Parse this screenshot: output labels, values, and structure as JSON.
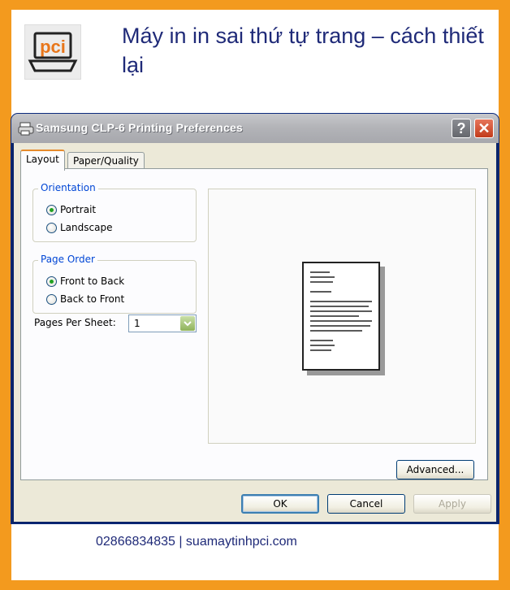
{
  "page": {
    "headline": "Máy in in sai thứ tự trang – cách thiết lại",
    "footer": "02866834835 | suamaytinhpci.com",
    "logo_text": "pci"
  },
  "window": {
    "title": "Samsung CLP-6 Printing Preferences",
    "help_glyph": "?",
    "close_glyph": "✕"
  },
  "tabs": [
    {
      "label": "Layout",
      "active": true
    },
    {
      "label": "Paper/Quality",
      "active": false
    }
  ],
  "orientation": {
    "legend": "Orientation",
    "options": [
      {
        "label": "Portrait",
        "checked": true
      },
      {
        "label": "Landscape",
        "checked": false
      }
    ]
  },
  "page_order": {
    "legend": "Page Order",
    "options": [
      {
        "label": "Front to Back",
        "checked": true
      },
      {
        "label": "Back to Front",
        "checked": false
      }
    ]
  },
  "pages_per_sheet": {
    "label": "Pages Per Sheet:",
    "value": "1"
  },
  "buttons": {
    "advanced": "Advanced...",
    "ok": "OK",
    "cancel": "Cancel",
    "apply": "Apply"
  },
  "colors": {
    "frame": "#f39a1e",
    "headline": "#1f2a78",
    "window_bg": "#ece9d8",
    "tab_accent": "#e68b2c",
    "radio_dot": "#21a121"
  }
}
